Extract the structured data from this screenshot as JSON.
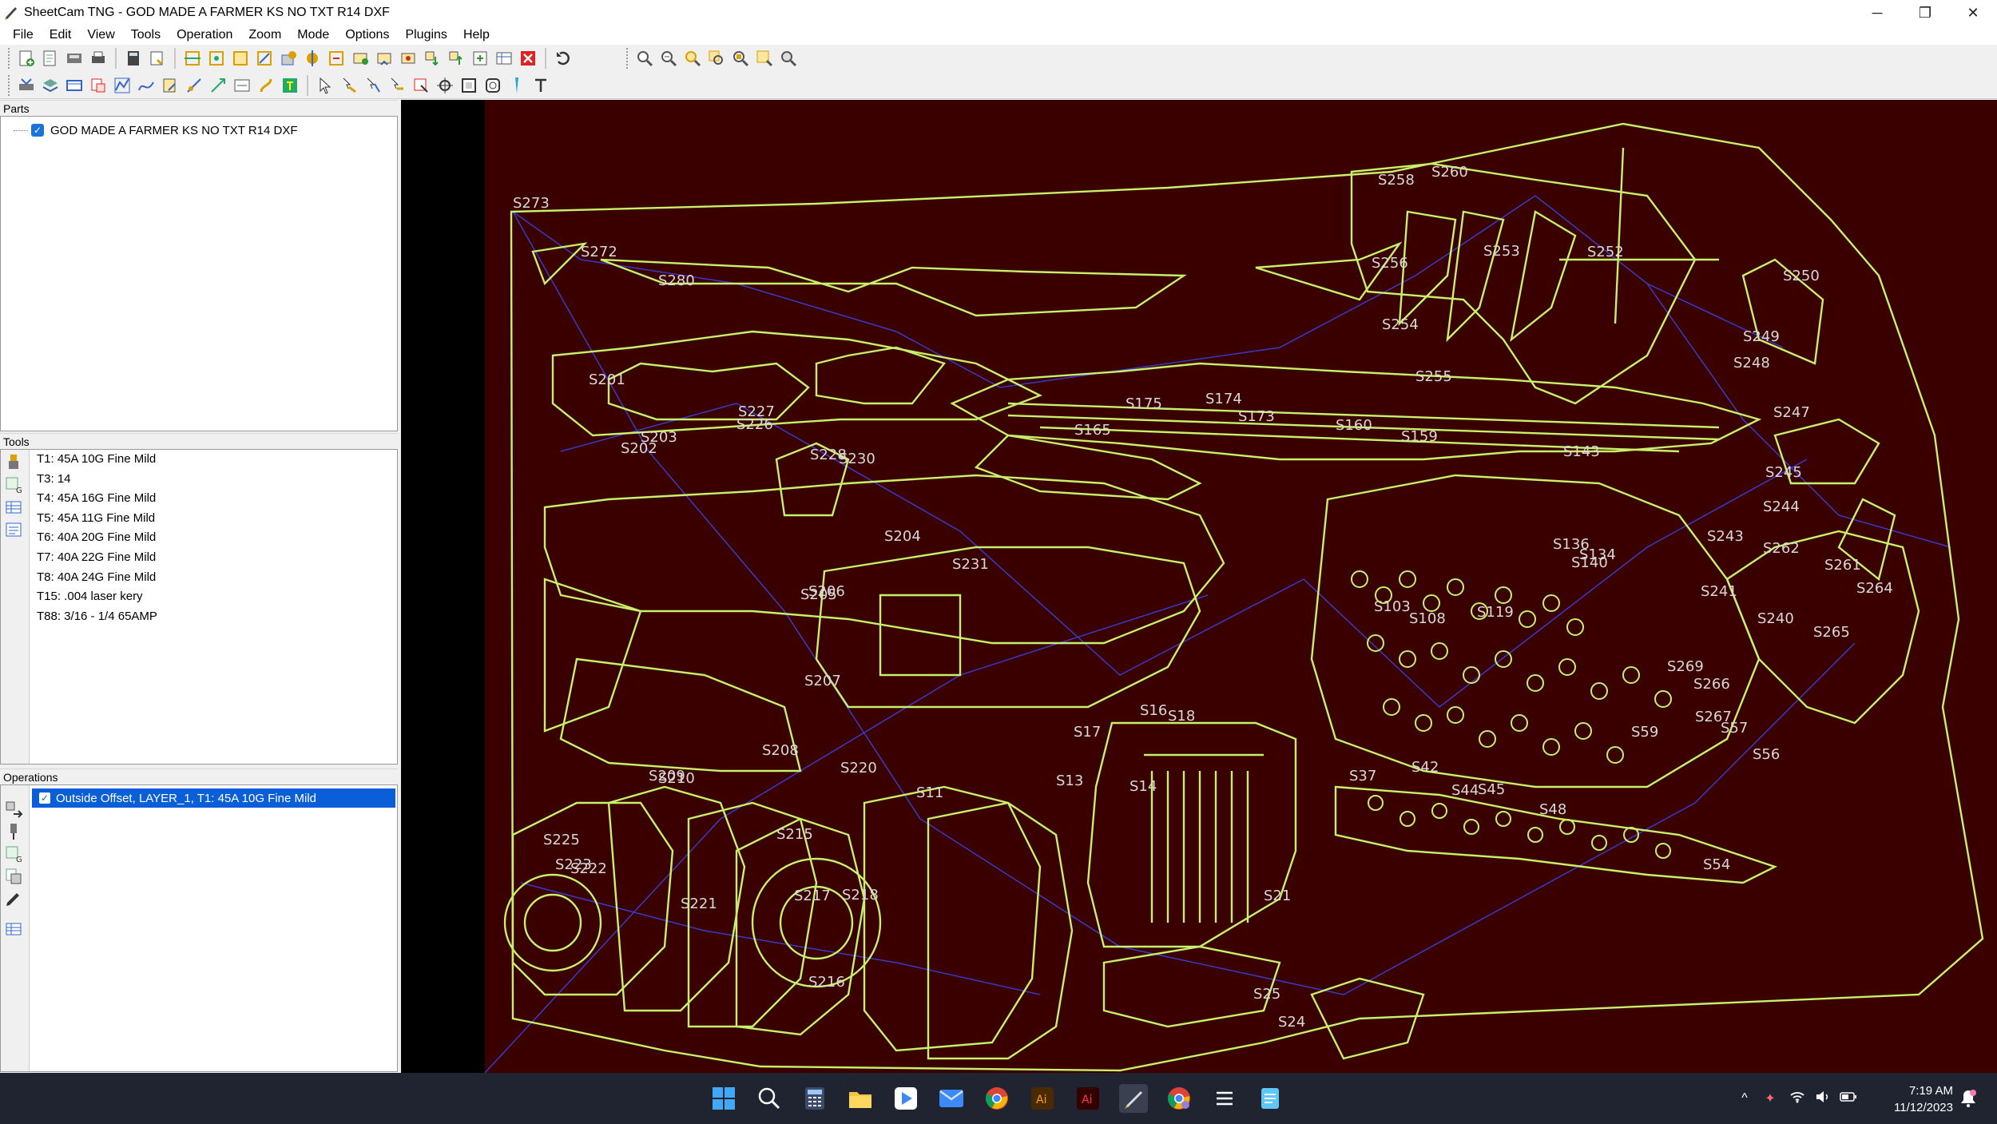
{
  "window": {
    "title": "SheetCam TNG - GOD MADE A FARMER KS NO TXT R14 DXF",
    "controls": {
      "minimize": "─",
      "maximize": "❐",
      "close": "✕"
    }
  },
  "menu": [
    "File",
    "Edit",
    "View",
    "Tools",
    "Operation",
    "Zoom",
    "Mode",
    "Options",
    "Plugins",
    "Help"
  ],
  "parts": {
    "header": "Parts",
    "items": [
      {
        "label": "GOD MADE A FARMER KS NO TXT R14 DXF",
        "checked": true
      }
    ]
  },
  "tools": {
    "header": "Tools",
    "items": [
      "T1: 45A 10G Fine Mild",
      "T3: 14",
      "T4: 45A 16G Fine Mild",
      "T5: 45A 11G Fine Mild",
      "T6: 40A 20G Fine Mild",
      "T7: 40A 22G Fine Mild",
      "T8: 40A 24G Fine Mild",
      "T15: .004 laser kery",
      "T88: 3/16 - 1/4 65AMP"
    ]
  },
  "operations": {
    "header": "Operations",
    "items": [
      {
        "label": "Outside Offset, LAYER_1, T1: 45A 10G Fine Mild",
        "checked": true,
        "selected": true
      }
    ]
  },
  "canvas": {
    "background": "#3a0000",
    "path_color": "#c8f06a",
    "rapid_color": "#3333cc",
    "labels": [
      {
        "t": "S273"
      },
      {
        "t": "S272"
      },
      {
        "t": "S280"
      },
      {
        "t": "S201"
      },
      {
        "t": "S227"
      },
      {
        "t": "S226"
      },
      {
        "t": "S203"
      },
      {
        "t": "S202"
      },
      {
        "t": "S228"
      },
      {
        "t": "S230"
      },
      {
        "t": "S258"
      },
      {
        "t": "S260"
      },
      {
        "t": "S256"
      },
      {
        "t": "S253"
      },
      {
        "t": "S252"
      },
      {
        "t": "S250"
      },
      {
        "t": "S254"
      },
      {
        "t": "S249"
      },
      {
        "t": "S248"
      },
      {
        "t": "S255"
      },
      {
        "t": "S174"
      },
      {
        "t": "S175"
      },
      {
        "t": "S173"
      },
      {
        "t": "S165"
      },
      {
        "t": "S160"
      },
      {
        "t": "S159"
      },
      {
        "t": "S143"
      },
      {
        "t": "S247"
      },
      {
        "t": "S245"
      },
      {
        "t": "S244"
      },
      {
        "t": "S243"
      },
      {
        "t": "S262"
      },
      {
        "t": "S261"
      },
      {
        "t": "S264"
      },
      {
        "t": "S241"
      },
      {
        "t": "S240"
      },
      {
        "t": "S265"
      },
      {
        "t": "S204"
      },
      {
        "t": "S231"
      },
      {
        "t": "S205"
      },
      {
        "t": "S206"
      },
      {
        "t": "S207"
      },
      {
        "t": "S208"
      },
      {
        "t": "S209"
      },
      {
        "t": "S210"
      },
      {
        "t": "S220"
      },
      {
        "t": "S11"
      },
      {
        "t": "S13"
      },
      {
        "t": "S14"
      },
      {
        "t": "S17"
      },
      {
        "t": "S18"
      },
      {
        "t": "S16"
      },
      {
        "t": "S225"
      },
      {
        "t": "S223"
      },
      {
        "t": "S222"
      },
      {
        "t": "S215"
      },
      {
        "t": "S217"
      },
      {
        "t": "S218"
      },
      {
        "t": "S216"
      },
      {
        "t": "S221"
      },
      {
        "t": "S37"
      },
      {
        "t": "S42"
      },
      {
        "t": "S44"
      },
      {
        "t": "S45"
      },
      {
        "t": "S48"
      },
      {
        "t": "S54"
      },
      {
        "t": "S56"
      },
      {
        "t": "S57"
      },
      {
        "t": "S59"
      },
      {
        "t": "S266"
      },
      {
        "t": "S267"
      },
      {
        "t": "S269"
      },
      {
        "t": "S108"
      },
      {
        "t": "S103"
      },
      {
        "t": "S119"
      },
      {
        "t": "S134"
      },
      {
        "t": "S136"
      },
      {
        "t": "S140"
      },
      {
        "t": "S21"
      },
      {
        "t": "S24"
      },
      {
        "t": "S25"
      }
    ]
  },
  "taskbar": {
    "time": "7:19 AM",
    "date": "11/12/2023"
  }
}
